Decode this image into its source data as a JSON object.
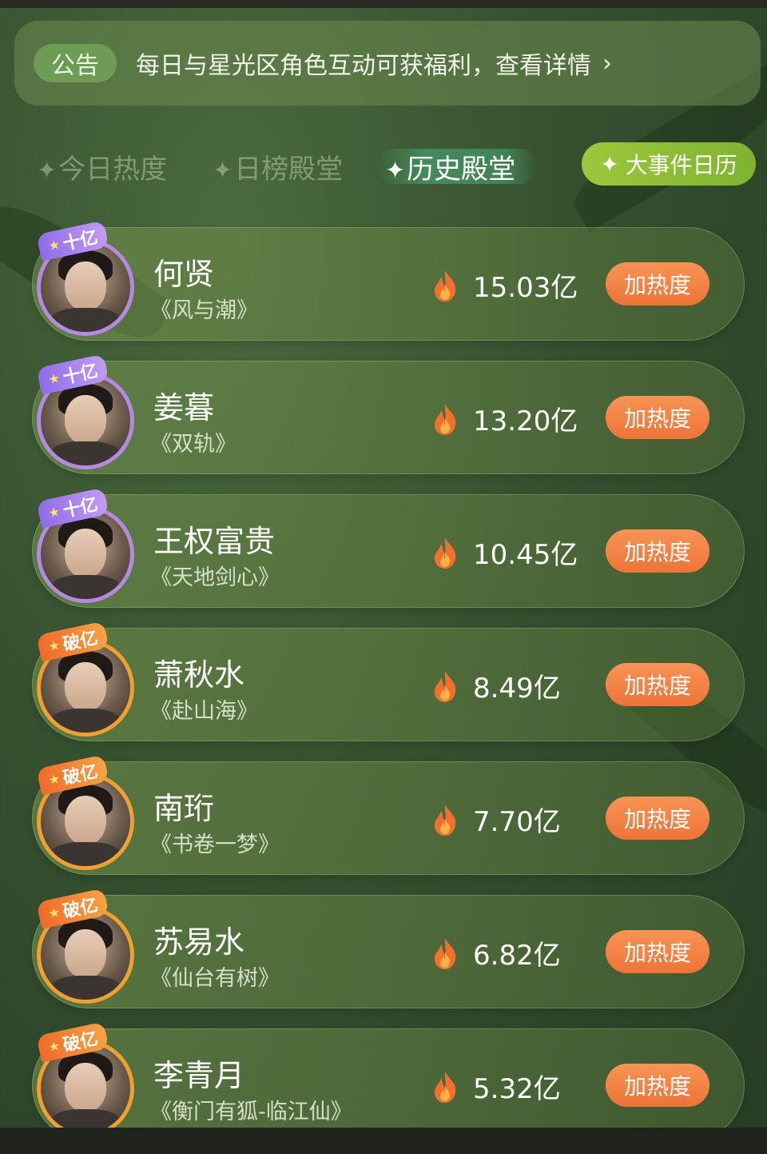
{
  "announcement": {
    "tag": "公告",
    "text": "每日与星光区角色互动可获福利，查看详情",
    "chevron": "›"
  },
  "tabs": [
    {
      "label": "今日热度",
      "active": false
    },
    {
      "label": "日榜殿堂",
      "active": false
    },
    {
      "label": "历史殿堂",
      "active": true
    }
  ],
  "event_button": {
    "icon": "sparkle-icon",
    "label": "大事件日历"
  },
  "ranking": [
    {
      "name": "何贤",
      "work": "《风与潮》",
      "heat": "15.03亿",
      "badge": "十亿",
      "badge_style": "purple",
      "action": "加热度"
    },
    {
      "name": "姜暮",
      "work": "《双轨》",
      "heat": "13.20亿",
      "badge": "十亿",
      "badge_style": "purple",
      "action": "加热度"
    },
    {
      "name": "王权富贵",
      "work": "《天地剑心》",
      "heat": "10.45亿",
      "badge": "十亿",
      "badge_style": "purple",
      "action": "加热度"
    },
    {
      "name": "萧秋水",
      "work": "《赴山海》",
      "heat": "8.49亿",
      "badge": "破亿",
      "badge_style": "orange",
      "action": "加热度"
    },
    {
      "name": "南珩",
      "work": "《书卷一梦》",
      "heat": "7.70亿",
      "badge": "破亿",
      "badge_style": "orange",
      "action": "加热度"
    },
    {
      "name": "苏易水",
      "work": "《仙台有树》",
      "heat": "6.82亿",
      "badge": "破亿",
      "badge_style": "orange",
      "action": "加热度"
    },
    {
      "name": "李青月",
      "work": "《衡门有狐-临江仙》",
      "heat": "5.32亿",
      "badge": "破亿",
      "badge_style": "orange",
      "action": "加热度"
    }
  ],
  "colors": {
    "accent_green": "#7fb330",
    "action_orange": "#ee7438",
    "badge_purple": "#8e6ce8",
    "badge_orange": "#ef6a2a"
  }
}
